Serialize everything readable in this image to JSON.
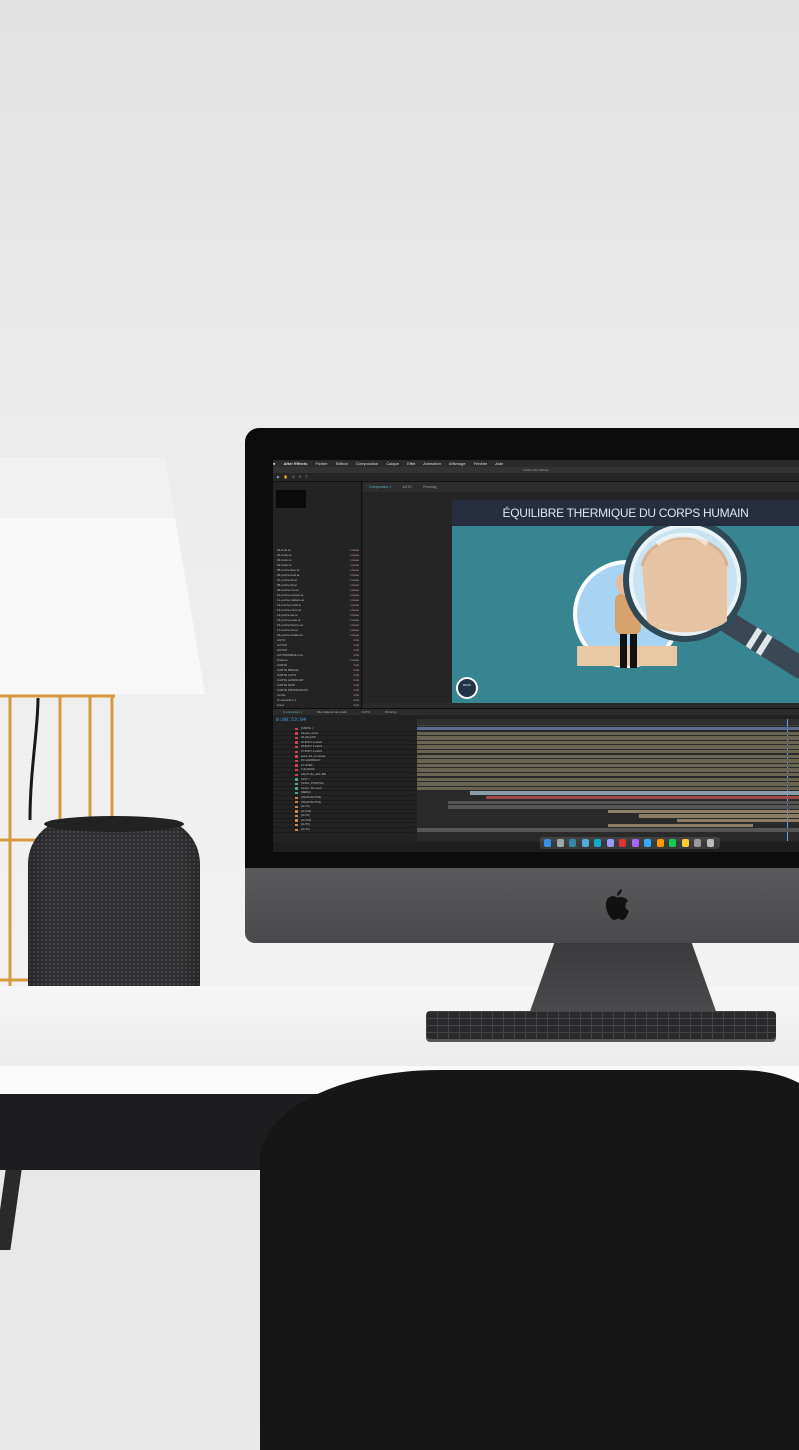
{
  "menubar": {
    "items": [
      "After Effects",
      "Fichier",
      "Edition",
      "Composition",
      "Calque",
      "Effet",
      "Animation",
      "Affichage",
      "Fenêtre",
      "Aide"
    ]
  },
  "window": {
    "title": "Adobe After Effects"
  },
  "project": {
    "items": [
      {
        "name": "01-fond.ai",
        "type": "Lisssé"
      },
      {
        "name": "02-bodiv.ai",
        "type": "Lisssé"
      },
      {
        "name": "03-bodiv.ai",
        "type": "Lisssé"
      },
      {
        "name": "04-bodiv.ai",
        "type": "Lisssé"
      },
      {
        "name": "05-poche-fleur.ai",
        "type": "Lisssé"
      },
      {
        "name": "06-poche-feuil.ai",
        "type": "Lisssé"
      },
      {
        "name": "07-poche-02.ai",
        "type": "Lisssé"
      },
      {
        "name": "08-poche-03.ai",
        "type": "Lisssé"
      },
      {
        "name": "09-poche-mol.ai",
        "type": "Lisssé"
      },
      {
        "name": "10-poche-contact.ai",
        "type": "Lisssé"
      },
      {
        "name": "11-poche-mallette.ai",
        "type": "Lisssé"
      },
      {
        "name": "12-poche-metal.ai",
        "type": "Lisssé"
      },
      {
        "name": "13-poche-miroir.ai",
        "type": "Lisssé"
      },
      {
        "name": "14-poche-sel.ai",
        "type": "Lisssé"
      },
      {
        "name": "15-poche-peau.ai",
        "type": "Lisssé"
      },
      {
        "name": "16-poche-thermo.ai",
        "type": "Lisssé"
      },
      {
        "name": "17-poche-sol.ai",
        "type": "Lisssé"
      },
      {
        "name": "18-poche-radiant.ai",
        "type": "Lisssé"
      },
      {
        "name": "AUTO",
        "type": "Gris"
      },
      {
        "name": "AUTO2",
        "type": "Gris"
      },
      {
        "name": "AUTO3",
        "type": "Gris"
      },
      {
        "name": "AUTOMOBILE.mov",
        "type": "Gris"
      },
      {
        "name": "Capture",
        "type": "Lisssé"
      },
      {
        "name": "CARTE",
        "type": "Gris"
      },
      {
        "name": "CARTE BRAGE",
        "type": "Gris"
      },
      {
        "name": "CARTE AUTO",
        "type": "Gris"
      },
      {
        "name": "CARTE HANDICAP",
        "type": "Gris"
      },
      {
        "name": "CARTE MOD",
        "type": "Gris"
      },
      {
        "name": "CARTE PROFESSION",
        "type": "Gris"
      },
      {
        "name": "Cercle",
        "type": "Gris"
      },
      {
        "name": "Composition 1",
        "type": "Gris"
      },
      {
        "name": "Fond",
        "type": "Gris"
      },
      {
        "name": "Piste",
        "type": "Lisssé"
      }
    ]
  },
  "composition": {
    "tabs": [
      "Composition 1",
      "AUTO",
      "Pictoring"
    ],
    "heading": "ÉQUILIBRE THERMIQUE DU CORPS HUMAIN",
    "logo_text": "RFCK"
  },
  "timeline": {
    "tabs": [
      "Composition 1",
      "File d'attente de rendu",
      "AUTO",
      "Pictoring"
    ],
    "timecode": "0:00:53:04",
    "layers": [
      {
        "name": "[CARTE...]",
        "color": "#c44"
      },
      {
        "name": "Réseau_souris",
        "color": "#c44"
      },
      {
        "name": "38-HALLOW",
        "color": "#c44"
      },
      {
        "name": "30-BODY & LEGS",
        "color": "#c44"
      },
      {
        "name": "28-BODY & LEGS",
        "color": "#c44"
      },
      {
        "name": "27-BODY & LEGS",
        "color": "#c44"
      },
      {
        "name": "jaune nuit_au reposé",
        "color": "#c44"
      },
      {
        "name": "DO-HANDMOUT",
        "color": "#c44"
      },
      {
        "name": "41 HIVER",
        "color": "#c44"
      },
      {
        "name": "TLE MAINS",
        "color": "#c44"
      },
      {
        "name": "HIGHT HLL_ECL-BIN",
        "color": "#c44"
      },
      {
        "name": "TEXT 1",
        "color": "#4a8"
      },
      {
        "name": "[Chiffre_POSITIVE]",
        "color": "#4a8"
      },
      {
        "name": "Cercle - Piet auv0",
        "color": "#4a8"
      },
      {
        "name": "[MEDIA]",
        "color": "#4a8"
      },
      {
        "name": "[TRAFFIANTTRI]",
        "color": "#c84"
      },
      {
        "name": "[TRAFFIANTTRI]",
        "color": "#c84"
      },
      {
        "name": "[AUTO]",
        "color": "#c84"
      },
      {
        "name": "[AUTO2]",
        "color": "#c84"
      },
      {
        "name": "[AUTO]",
        "color": "#c84"
      },
      {
        "name": "[AUTO3]",
        "color": "#c84"
      },
      {
        "name": "[AUTO]",
        "color": "#c84"
      },
      {
        "name": "[AUTO]",
        "color": "#c84"
      }
    ],
    "bars": [
      {
        "start": 0.0,
        "end": 1.0,
        "color": "#5b6a8a"
      },
      {
        "start": 0.0,
        "end": 1.0,
        "color": "#6a6452"
      },
      {
        "start": 0.0,
        "end": 1.0,
        "color": "#6a6452"
      },
      {
        "start": 0.0,
        "end": 1.0,
        "color": "#6a6452"
      },
      {
        "start": 0.0,
        "end": 1.0,
        "color": "#6a6452"
      },
      {
        "start": 0.0,
        "end": 1.0,
        "color": "#6a6452"
      },
      {
        "start": 0.0,
        "end": 1.0,
        "color": "#6a6452"
      },
      {
        "start": 0.0,
        "end": 1.0,
        "color": "#6a6452"
      },
      {
        "start": 0.0,
        "end": 1.0,
        "color": "#6a6452"
      },
      {
        "start": 0.0,
        "end": 1.0,
        "color": "#6a6452"
      },
      {
        "start": 0.0,
        "end": 1.0,
        "color": "#6a6452"
      },
      {
        "start": 0.0,
        "end": 1.0,
        "color": "#6a6452"
      },
      {
        "start": 0.0,
        "end": 1.0,
        "color": "#6a6452"
      },
      {
        "start": 0.0,
        "end": 1.0,
        "color": "#6a6452"
      },
      {
        "start": 0.14,
        "end": 1.0,
        "color": "#8a9ca6"
      },
      {
        "start": 0.18,
        "end": 1.0,
        "color": "#a04a4a"
      },
      {
        "start": 0.08,
        "end": 1.0,
        "color": "#555"
      },
      {
        "start": 0.08,
        "end": 1.0,
        "color": "#555"
      },
      {
        "start": 0.5,
        "end": 1.0,
        "color": "#8c7e66"
      },
      {
        "start": 0.58,
        "end": 1.0,
        "color": "#8c7e66"
      },
      {
        "start": 0.68,
        "end": 1.0,
        "color": "#8c7e66"
      },
      {
        "start": 0.5,
        "end": 0.88,
        "color": "#8c7e66"
      },
      {
        "start": 0.0,
        "end": 1.0,
        "color": "#555"
      }
    ]
  },
  "dock": {
    "icons": [
      "finder-icon",
      "launchpad-icon",
      "safari-icon",
      "mail-icon",
      "lightroom-icon",
      "after-effects-icon",
      "acrobat-icon",
      "premiere-icon",
      "photoshop-icon",
      "illustrator-icon",
      "spotify-icon",
      "chrome-icon",
      "settings-icon",
      "trash-icon"
    ],
    "colors": [
      "#3a8ee8",
      "#9aa",
      "#38a",
      "#5ad",
      "#1ac",
      "#99f",
      "#d33",
      "#a6f",
      "#3af",
      "#f90",
      "#1c5",
      "#fc3",
      "#999",
      "#bbb"
    ]
  }
}
